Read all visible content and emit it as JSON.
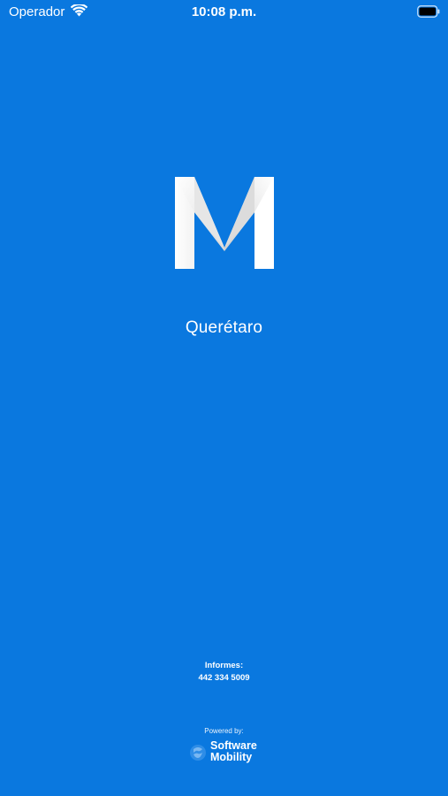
{
  "status_bar": {
    "carrier": "Operador",
    "time": "10:08 p.m.",
    "wifi_icon": "wifi-icon",
    "battery_icon": "battery-icon"
  },
  "splash": {
    "logo_icon": "m-logo-icon",
    "city": "Querétaro"
  },
  "footer": {
    "info_label": "Informes:",
    "info_phone": "442 334 5009",
    "powered_by": "Powered by:",
    "brand_line1": "Software",
    "brand_line2": "Mobility"
  },
  "colors": {
    "background": "#0a78df",
    "text": "#ffffff"
  }
}
